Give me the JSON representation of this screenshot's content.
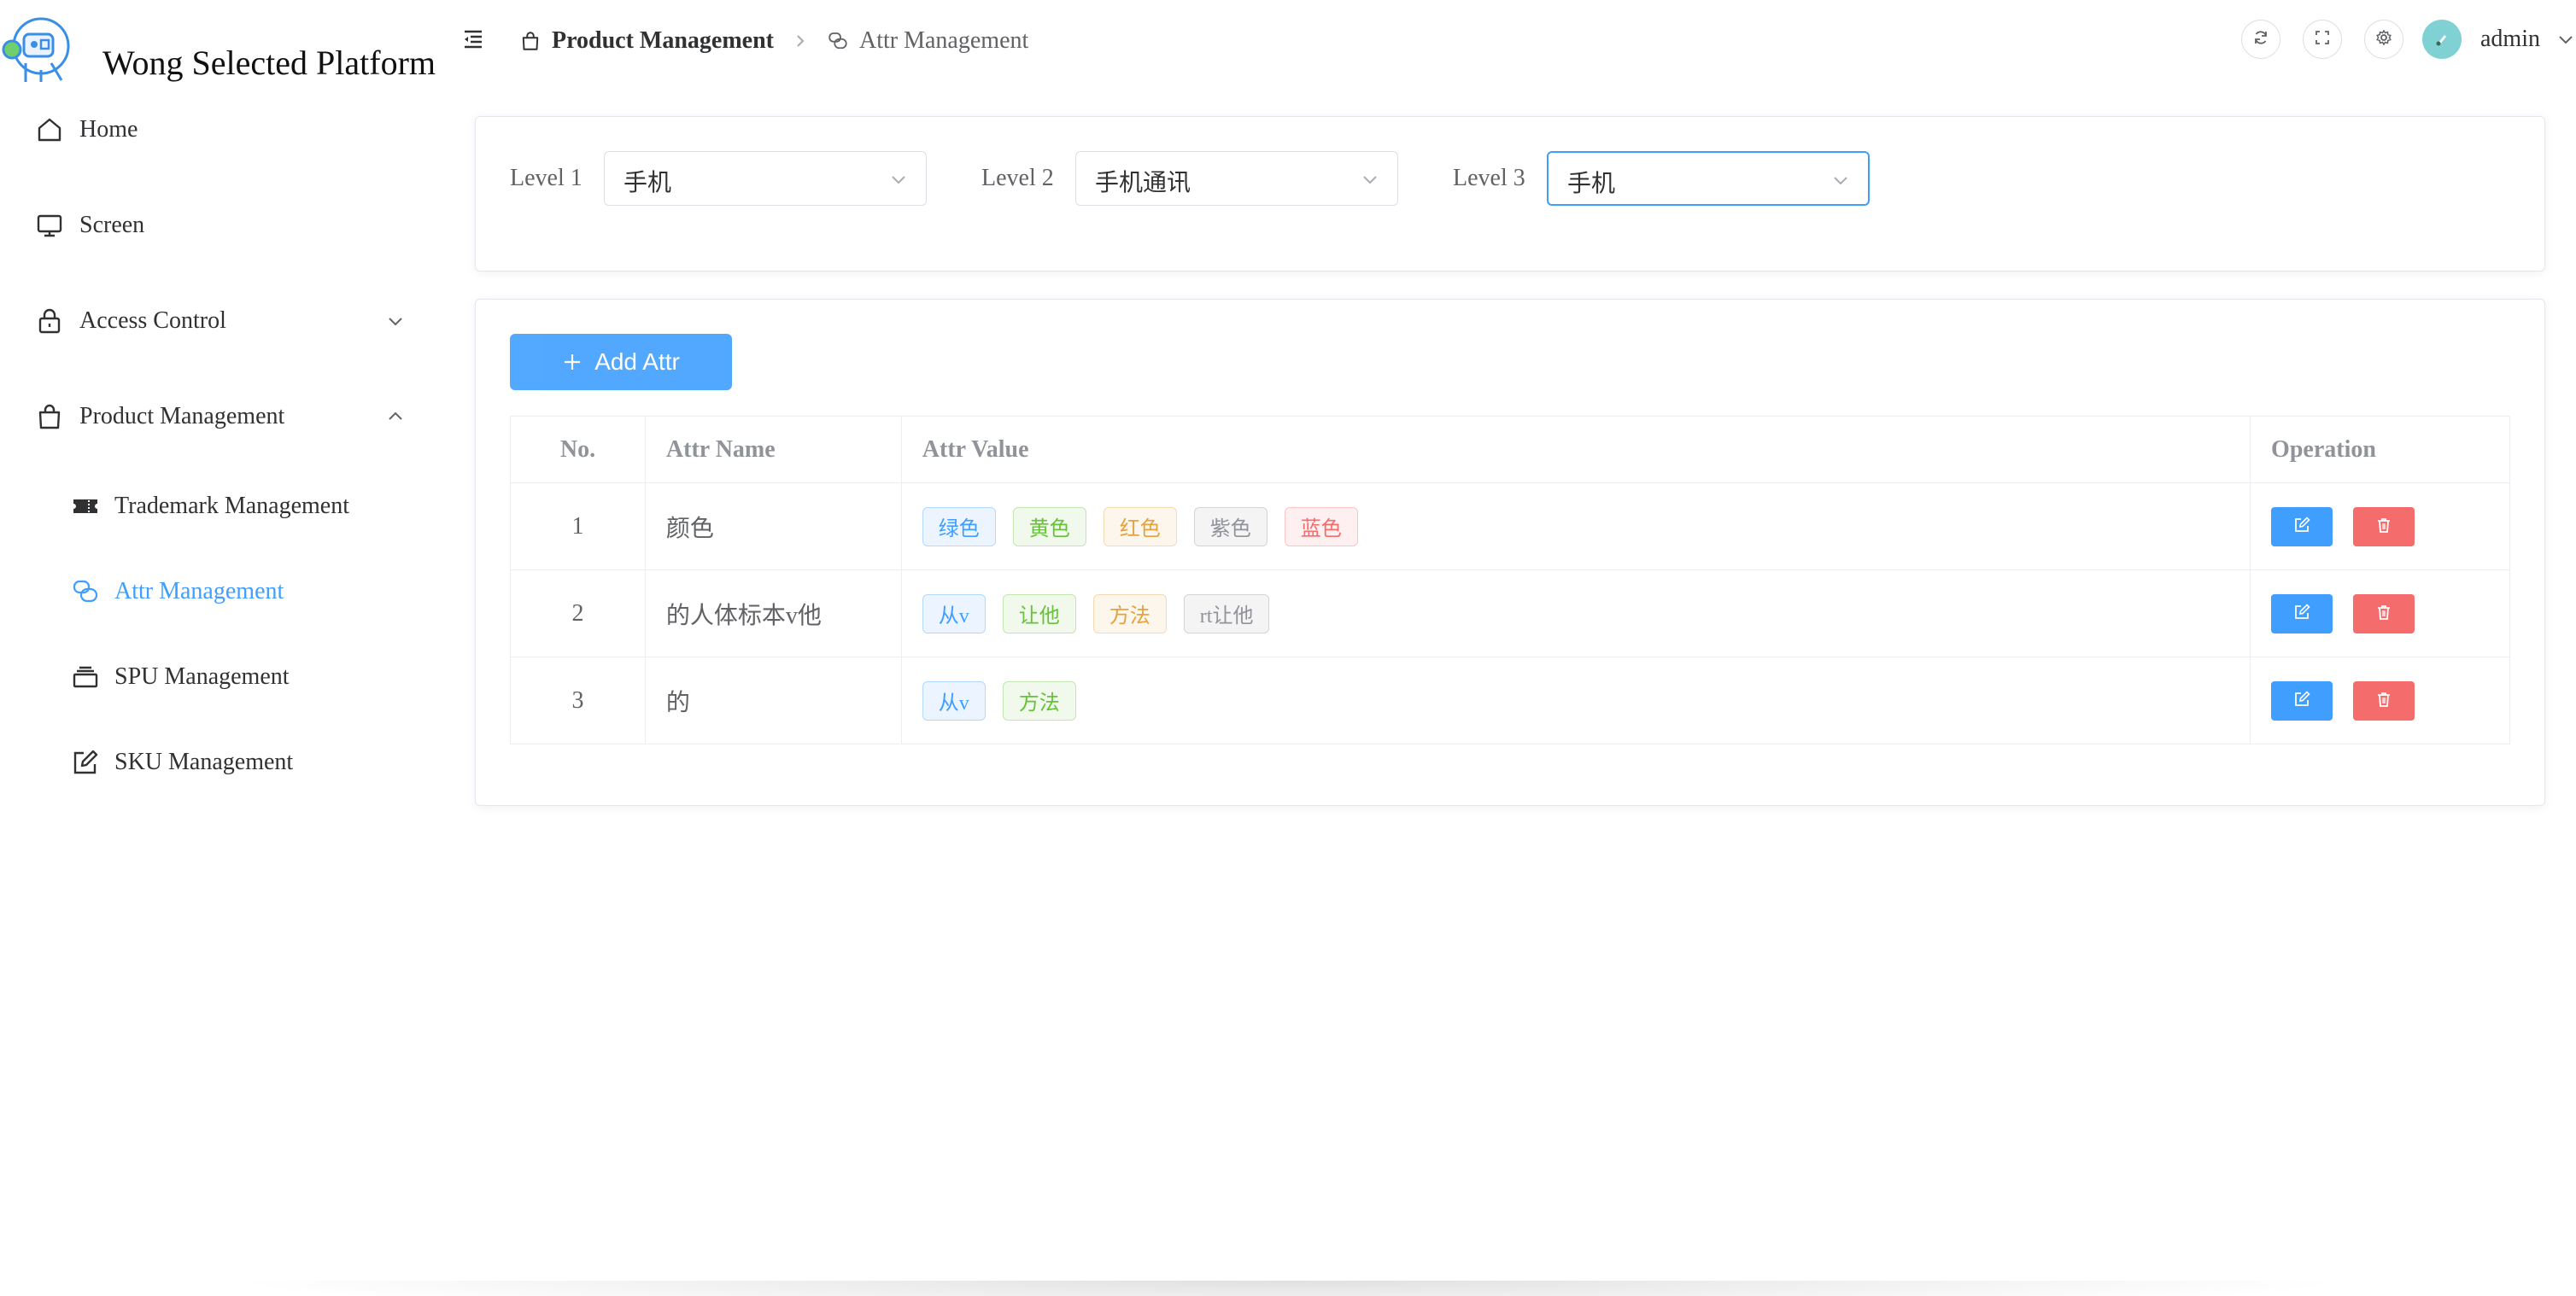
{
  "brand": {
    "title": "Wong Selected Platform",
    "logo_icon": "robot-logo-icon"
  },
  "sidebar": {
    "items": [
      {
        "label": "Home",
        "icon": "home-icon"
      },
      {
        "label": "Screen",
        "icon": "monitor-icon"
      },
      {
        "label": "Access Control",
        "icon": "lock-icon",
        "arrow": "chevron-down-icon"
      },
      {
        "label": "Product Management",
        "icon": "shopping-bag-icon",
        "arrow": "chevron-up-icon",
        "expanded": true
      },
      {
        "label": "Trademark Management",
        "icon": "ticket-icon"
      },
      {
        "label": "Attr Management",
        "icon": "chat-bubbles-icon",
        "active": true
      },
      {
        "label": "SPU Management",
        "icon": "stack-icon"
      },
      {
        "label": "SKU Management",
        "icon": "edit-icon"
      }
    ]
  },
  "header": {
    "breadcrumb": [
      {
        "label": "Product Management",
        "icon": "shopping-bag-icon"
      },
      {
        "label": "Attr Management",
        "icon": "chat-bubbles-icon"
      }
    ],
    "user": {
      "name": "admin"
    }
  },
  "filters": {
    "level1": {
      "label": "Level 1",
      "value": "手机"
    },
    "level2": {
      "label": "Level 2",
      "value": "手机通讯"
    },
    "level3": {
      "label": "Level 3",
      "value": "手机"
    }
  },
  "actions": {
    "add_label": "Add Attr"
  },
  "table": {
    "headers": {
      "no": "No.",
      "name": "Attr Name",
      "value": "Attr Value",
      "operation": "Operation"
    },
    "rows": [
      {
        "no": "1",
        "name": "颜色",
        "values": [
          "绿色",
          "黄色",
          "红色",
          "紫色",
          "蓝色"
        ]
      },
      {
        "no": "2",
        "name": "的人体标本v他",
        "values": [
          "从v",
          "让他",
          "方法",
          "rt让他"
        ]
      },
      {
        "no": "3",
        "name": "的",
        "values": [
          "从v",
          "方法"
        ]
      }
    ]
  },
  "colors": {
    "accent": "#409eff",
    "danger": "#f56c6c",
    "tag_types": [
      "primary",
      "success",
      "warning",
      "info",
      "danger"
    ]
  }
}
